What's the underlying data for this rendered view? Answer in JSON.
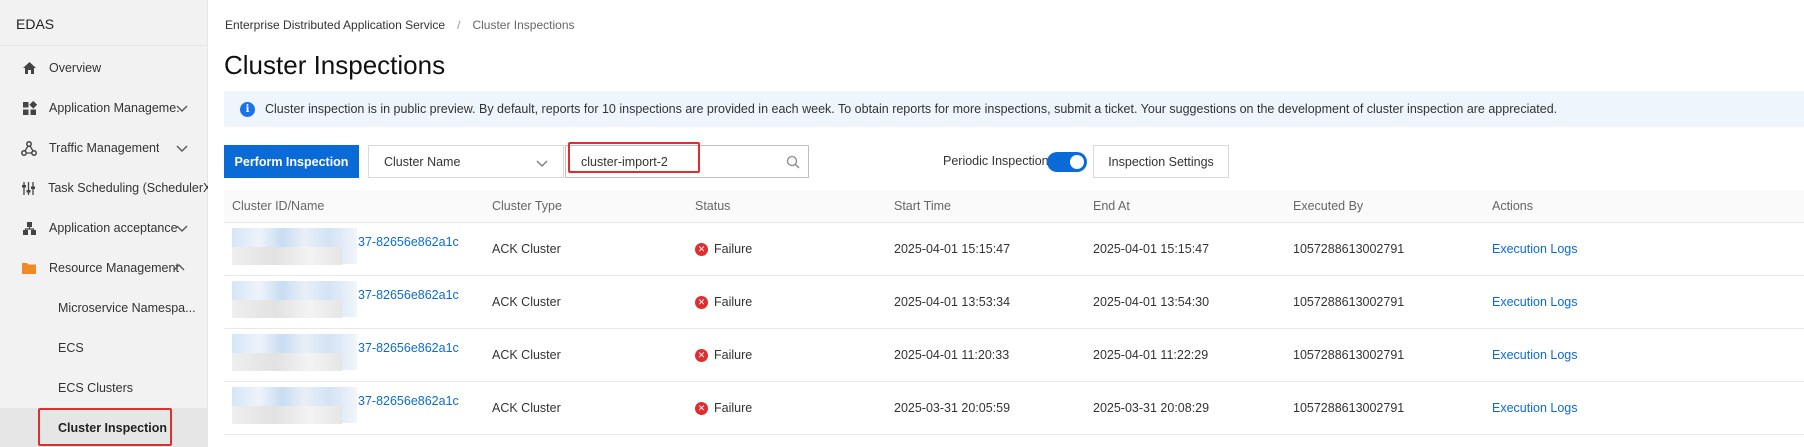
{
  "app": {
    "name": "EDAS"
  },
  "sidebar": {
    "items": [
      {
        "label": "Overview",
        "icon": "home-icon"
      },
      {
        "label": "Application Manageme...",
        "icon": "apps-grid-icon",
        "expand": "down"
      },
      {
        "label": "Traffic Management",
        "icon": "traffic-icon",
        "expand": "down"
      },
      {
        "label": "Task Scheduling (SchedulerX)",
        "icon": "scheduler-icon"
      },
      {
        "label": "Application acceptance",
        "icon": "acceptance-icon",
        "expand": "down"
      },
      {
        "label": "Resource Management",
        "icon": "folder-icon",
        "expand": "up"
      }
    ],
    "subitems": [
      {
        "label": "Microservice Namespa..."
      },
      {
        "label": "ECS"
      },
      {
        "label": "ECS Clusters"
      },
      {
        "label": "Cluster Inspection",
        "active": true
      }
    ]
  },
  "breadcrumb": {
    "root": "Enterprise Distributed Application Service",
    "separator": "/",
    "current": "Cluster Inspections"
  },
  "page": {
    "title": "Cluster Inspections",
    "notice": "Cluster inspection is in public preview. By default, reports for 10 inspections are provided in each week. To obtain reports for more inspections, submit a ticket. Your suggestions on the development of cluster inspection are appreciated."
  },
  "toolbar": {
    "perform_label": "Perform Inspection",
    "filter_select": "Cluster Name",
    "search_value": "cluster-import-2",
    "periodic_label": "Periodic Inspection:",
    "periodic_enabled": true,
    "settings_label": "Inspection Settings"
  },
  "table": {
    "columns": [
      "Cluster ID/Name",
      "Cluster Type",
      "Status",
      "Start Time",
      "End At",
      "Executed By",
      "Actions"
    ],
    "rows": [
      {
        "id_suffix": "37-82656e862a1c",
        "type": "ACK Cluster",
        "status": "Failure",
        "start": "2025-04-01 15:15:47",
        "end": "2025-04-01 15:15:47",
        "executed_by": "1057288613002791",
        "action": "Execution Logs"
      },
      {
        "id_suffix": "37-82656e862a1c",
        "type": "ACK Cluster",
        "status": "Failure",
        "start": "2025-04-01 13:53:34",
        "end": "2025-04-01 13:54:30",
        "executed_by": "1057288613002791",
        "action": "Execution Logs"
      },
      {
        "id_suffix": "37-82656e862a1c",
        "type": "ACK Cluster",
        "status": "Failure",
        "start": "2025-04-01 11:20:33",
        "end": "2025-04-01 11:22:29",
        "executed_by": "1057288613002791",
        "action": "Execution Logs"
      },
      {
        "id_suffix": "37-82656e862a1c",
        "type": "ACK Cluster",
        "status": "Failure",
        "start": "2025-03-31 20:05:59",
        "end": "2025-03-31 20:08:29",
        "executed_by": "1057288613002791",
        "action": "Execution Logs"
      }
    ]
  },
  "colors": {
    "accent": "#0b6bd6",
    "failure": "#e02d2d",
    "highlight": "#e02d2d"
  }
}
